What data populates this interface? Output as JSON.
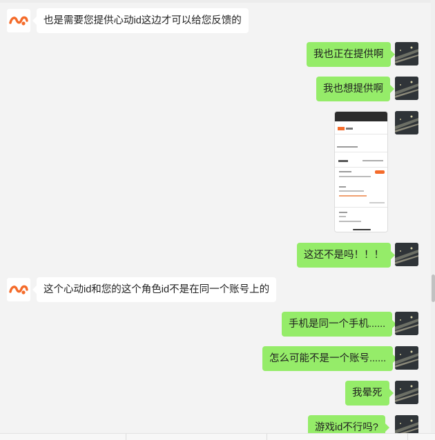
{
  "conversation": {
    "messages": [
      {
        "side": "left",
        "kind": "text",
        "text": "也是需要您提供心动id这边才可以给您反馈的"
      },
      {
        "side": "right",
        "kind": "text",
        "text": "我也正在提供啊"
      },
      {
        "side": "right",
        "kind": "text",
        "text": "我也想提供啊"
      },
      {
        "side": "right",
        "kind": "image",
        "text": "phone-screenshot"
      },
      {
        "side": "right",
        "kind": "text",
        "text": "这还不是吗！！！"
      },
      {
        "side": "left",
        "kind": "text",
        "text": "这个心动id和您的这个角色id不是在同一个账号上的"
      },
      {
        "side": "right",
        "kind": "text",
        "text": "手机是同一个手机......"
      },
      {
        "side": "right",
        "kind": "text",
        "text": "怎么可能不是一个账号......"
      },
      {
        "side": "right",
        "kind": "text",
        "text": "我晕死"
      },
      {
        "side": "right",
        "kind": "text",
        "text": "游戏id不行吗?"
      }
    ]
  },
  "colors": {
    "background": "#f3f3f3",
    "outgoing_bubble": "#95ec69",
    "incoming_bubble": "#ffffff",
    "brand_logo": "#f46b2a"
  },
  "icons": {
    "agent_avatar": "orange-wave-logo-icon",
    "user_avatar": "dark-photo-avatar"
  }
}
